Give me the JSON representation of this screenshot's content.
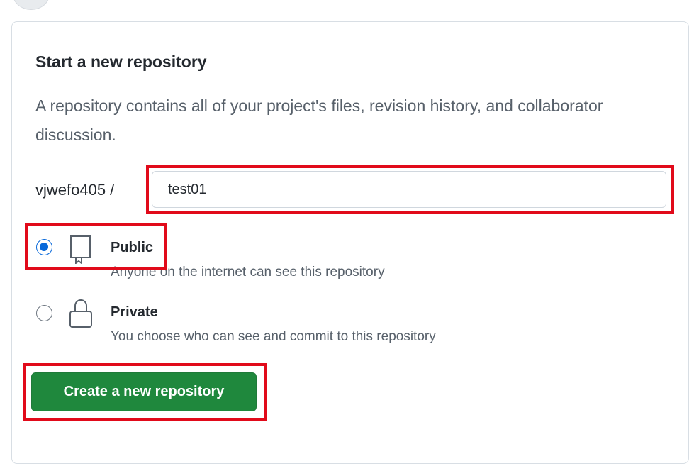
{
  "form": {
    "title": "Start a new repository",
    "description": "A repository contains all of your project's files, revision history, and collaborator discussion.",
    "owner": "vjwefo405 /",
    "repo_name_value": "test01"
  },
  "visibility": {
    "selected": "public",
    "options": [
      {
        "key": "public",
        "label": "Public",
        "description": "Anyone on the internet can see this repository",
        "icon": "repo-icon",
        "checked": true
      },
      {
        "key": "private",
        "label": "Private",
        "description": "You choose who can see and commit to this repository",
        "icon": "lock-icon",
        "checked": false
      }
    ]
  },
  "actions": {
    "create_label": "Create a new repository"
  },
  "colors": {
    "primary_button": "#1f883d",
    "radio_checked": "#0969da",
    "highlight_box": "#e10a1a"
  }
}
